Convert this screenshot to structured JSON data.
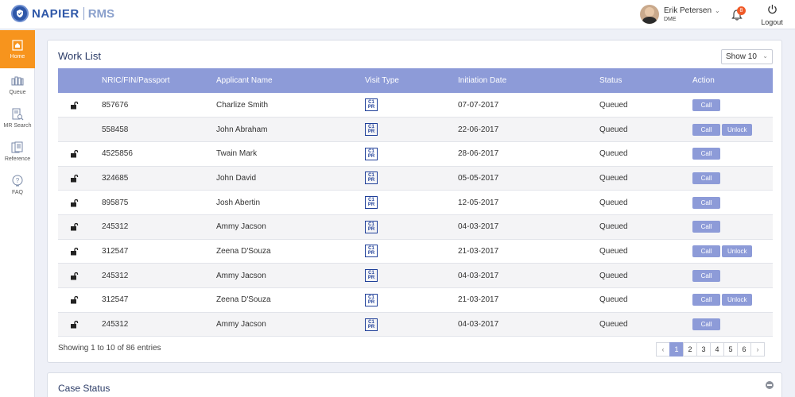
{
  "header": {
    "logo_text": "NAPIER",
    "logo_sub": "RMS",
    "user_name": "Erik Petersen",
    "user_role": "DME",
    "notification_count": "8",
    "logout_label": "Logout"
  },
  "sidebar": {
    "items": [
      {
        "label": "Home",
        "icon": "home-icon",
        "active": true
      },
      {
        "label": "Queue",
        "icon": "queue-icon",
        "active": false
      },
      {
        "label": "MR Search",
        "icon": "mr-search-icon",
        "active": false
      },
      {
        "label": "Reference",
        "icon": "reference-icon",
        "active": false
      },
      {
        "label": "FAQ",
        "icon": "faq-icon",
        "active": false
      }
    ]
  },
  "worklist": {
    "title": "Work List",
    "show_select": "Show 10",
    "columns": [
      "NRIC/FIN/Passport",
      "Applicant Name",
      "Visit Type",
      "Initiation Date",
      "Status",
      "Action"
    ],
    "visit_icon_text": {
      "line1": "C1",
      "line2": "PR"
    },
    "call_label": "Call",
    "unlock_label": "Unlock",
    "rows": [
      {
        "locked": true,
        "id": "857676",
        "name": "Charlize Smith",
        "date": "07-07-2017",
        "status": "Queued",
        "unlock": false
      },
      {
        "locked": false,
        "id": "558458",
        "name": "John Abraham",
        "date": "22-06-2017",
        "status": "Queued",
        "unlock": true
      },
      {
        "locked": true,
        "id": "4525856",
        "name": "Twain Mark",
        "date": "28-06-2017",
        "status": "Queued",
        "unlock": false
      },
      {
        "locked": true,
        "id": "324685",
        "name": "John David",
        "date": "05-05-2017",
        "status": "Queued",
        "unlock": false
      },
      {
        "locked": true,
        "id": "895875",
        "name": "Josh Abertin",
        "date": "12-05-2017",
        "status": "Queued",
        "unlock": false
      },
      {
        "locked": true,
        "id": "245312",
        "name": "Ammy Jacson",
        "date": "04-03-2017",
        "status": "Queued",
        "unlock": false
      },
      {
        "locked": true,
        "id": "312547",
        "name": "Zeena D'Souza",
        "date": "21-03-2017",
        "status": "Queued",
        "unlock": true
      },
      {
        "locked": true,
        "id": "245312",
        "name": "Ammy Jacson",
        "date": "04-03-2017",
        "status": "Queued",
        "unlock": false
      },
      {
        "locked": true,
        "id": "312547",
        "name": "Zeena D'Souza",
        "date": "21-03-2017",
        "status": "Queued",
        "unlock": true
      },
      {
        "locked": true,
        "id": "245312",
        "name": "Ammy Jacson",
        "date": "04-03-2017",
        "status": "Queued",
        "unlock": false
      }
    ],
    "showing_text": "Showing 1 to 10 of 86 entries",
    "pagination": {
      "prev": "‹",
      "pages": [
        "1",
        "2",
        "3",
        "4",
        "5",
        "6"
      ],
      "active_page": "1",
      "next": "›"
    }
  },
  "case_status": {
    "title": "Case Status"
  },
  "colors": {
    "accent": "#8d9bd8",
    "sidebar_active": "#f7941d",
    "brand": "#2e57a8",
    "badge": "#f05a28"
  }
}
